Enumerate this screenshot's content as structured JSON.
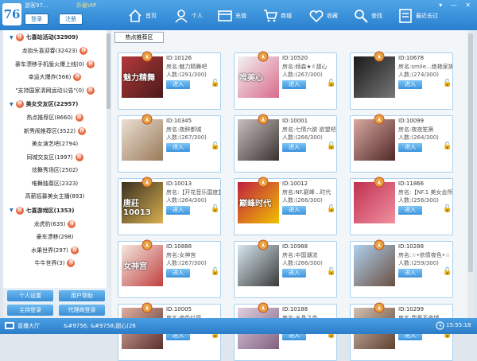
{
  "app": {
    "logo": "76",
    "guest_label": "游客97...",
    "upgrade_label": "升级VIP",
    "login_label": "登录",
    "register_label": "注册",
    "window_controls": "▾ — ✕"
  },
  "nav": [
    {
      "label": "首页",
      "icon": "home-icon"
    },
    {
      "label": "个人",
      "icon": "person-icon"
    },
    {
      "label": "充值",
      "icon": "recharge-icon"
    },
    {
      "label": "商城",
      "icon": "shop-icon"
    },
    {
      "label": "收藏",
      "icon": "heart-icon"
    },
    {
      "label": "查找",
      "icon": "search-icon"
    },
    {
      "label": "最近去过",
      "icon": "recent-icon"
    }
  ],
  "sidebar": {
    "cat1": {
      "label": "七喜站活动(32909)",
      "badge": "荐"
    },
    "items1": [
      {
        "label": "龙抬头喜迎春(32423)",
        "badge": "荐"
      },
      {
        "label": "豪车漂移手机版火爆上线(0)",
        "badge": "荐"
      },
      {
        "label": "幸运大爆炸(566)",
        "badge": "荐"
      },
      {
        "label": "\"支持国家清网运动公告\"(0)",
        "badge": "荐"
      }
    ],
    "cat2": {
      "label": "美女交友区(22957)",
      "badge": "荐"
    },
    "items2": [
      {
        "label": "热点推荐区(8660)",
        "badge": "荐"
      },
      {
        "label": "新秀闹推荐区(3522)",
        "badge": "荐"
      },
      {
        "label": "美女演艺吧(2794)"
      },
      {
        "label": "同城交友区(1997)",
        "badge": "荐"
      },
      {
        "label": "炫舞秀场区(2502)"
      },
      {
        "label": "唯舞独尊区(2323)"
      },
      {
        "label": "高薪招募美女主播(893)"
      }
    ],
    "cat3": {
      "label": "七喜游戏区(1353)",
      "badge": "荐"
    },
    "items3": [
      {
        "label": "龙虎豹(635)",
        "badge": "荐"
      },
      {
        "label": "豪车漂移(298)"
      },
      {
        "label": "水果世界(297)",
        "badge": "荐"
      },
      {
        "label": "牛牛世界(3)",
        "badge": "荐"
      }
    ],
    "buttons": {
      "personal": "个人设置",
      "help": "用户帮助",
      "anchor_login": "主持登录",
      "agent_login": "代理商登录"
    }
  },
  "main": {
    "tab": "热点推荐区",
    "enter_label": "进入",
    "rooms": [
      {
        "id": "ID:10126",
        "name": "房名:魅力精舞吧",
        "people": "人数:(291/300)",
        "thumb": "#b43a3a",
        "thumb2": "#4a1a1a",
        "thumb_text": "魅力精舞"
      },
      {
        "id": "ID:10520",
        "name": "房名:倾森★✌甜心",
        "people": "人数:(267/300)",
        "thumb": "#f2f2f2",
        "thumb2": "#d96a8a",
        "thumb_text": "唯美心"
      },
      {
        "id": "ID:10678",
        "name": "房名:smile...绝艳家族",
        "people": "人数:(274/300)",
        "thumb": "#1a1a1a",
        "thumb2": "#777",
        "thumb_text": ""
      },
      {
        "id": "ID:10345",
        "name": "房名:夜醉都城",
        "people": "人数:(267/300)",
        "thumb": "#eadfd2",
        "thumb2": "#9a7a5a",
        "thumb_text": ""
      },
      {
        "id": "ID:10001",
        "name": "房名:七情六欲 欲望吧",
        "people": "人数:(266/300)",
        "thumb": "#c8c0c0",
        "thumb2": "#3a3030",
        "thumb_text": ""
      },
      {
        "id": "ID:10099",
        "name": "房名:夜夜笙箫",
        "people": "人数:(264/300)",
        "thumb": "#d8a8a0",
        "thumb2": "#502828",
        "thumb_text": ""
      },
      {
        "id": "ID:10013",
        "name": "房名:【开花音乐国度】",
        "people": "人数:(264/300)",
        "thumb": "#3a3020",
        "thumb2": "#d8b050",
        "thumb_text": "唐莊10013"
      },
      {
        "id": "ID:10012",
        "name": "房名:NF.巅峰...时代",
        "people": "人数:(266/300)",
        "thumb": "#c02040",
        "thumb2": "#f0c000",
        "thumb_text": "巅峰时代"
      },
      {
        "id": "ID:11866",
        "name": "房名:【NF.1 美女会所】",
        "people": "人数:(256/300)",
        "thumb": "#c03050",
        "thumb2": "#f090a0",
        "thumb_text": ""
      },
      {
        "id": "ID:10888",
        "name": "房名:女神宫",
        "people": "人数:(267/300)",
        "thumb": "#f4e8e0",
        "thumb2": "#c04040",
        "thumb_text": "女神宫"
      },
      {
        "id": "ID:10988",
        "name": "房名:中国潮流",
        "people": "人数:(266/300)",
        "thumb": "#d8e8f0",
        "thumb2": "#3a3a3a",
        "thumb_text": ""
      },
      {
        "id": "ID:10288",
        "name": "房名:☆•依情夜色•☆",
        "people": "人数:(259/300)",
        "thumb": "#b0d0f0",
        "thumb2": "#6a5040",
        "thumb_text": ""
      },
      {
        "id": "ID:10005",
        "name": "房名:夜色红唇",
        "people": "人数:(267/300)",
        "thumb": "#e0b0a0",
        "thumb2": "#5a3030",
        "thumb_text": ""
      },
      {
        "id": "ID:10188",
        "name": "房名:水晶之恋",
        "people": "人数:(267/300)",
        "thumb": "#e0d0e0",
        "thumb2": "#806080",
        "thumb_text": ""
      },
      {
        "id": "ID:10299",
        "name": "房名:我爱不夜城",
        "people": "人数:(265/300)",
        "thumb": "#d0c0b0",
        "thumb2": "#604030",
        "thumb_text": ""
      }
    ]
  },
  "status": {
    "room_hall": "直播大厅",
    "marquee": "&#9756; &#9758;甜心(26",
    "clock": "15:55:18"
  }
}
